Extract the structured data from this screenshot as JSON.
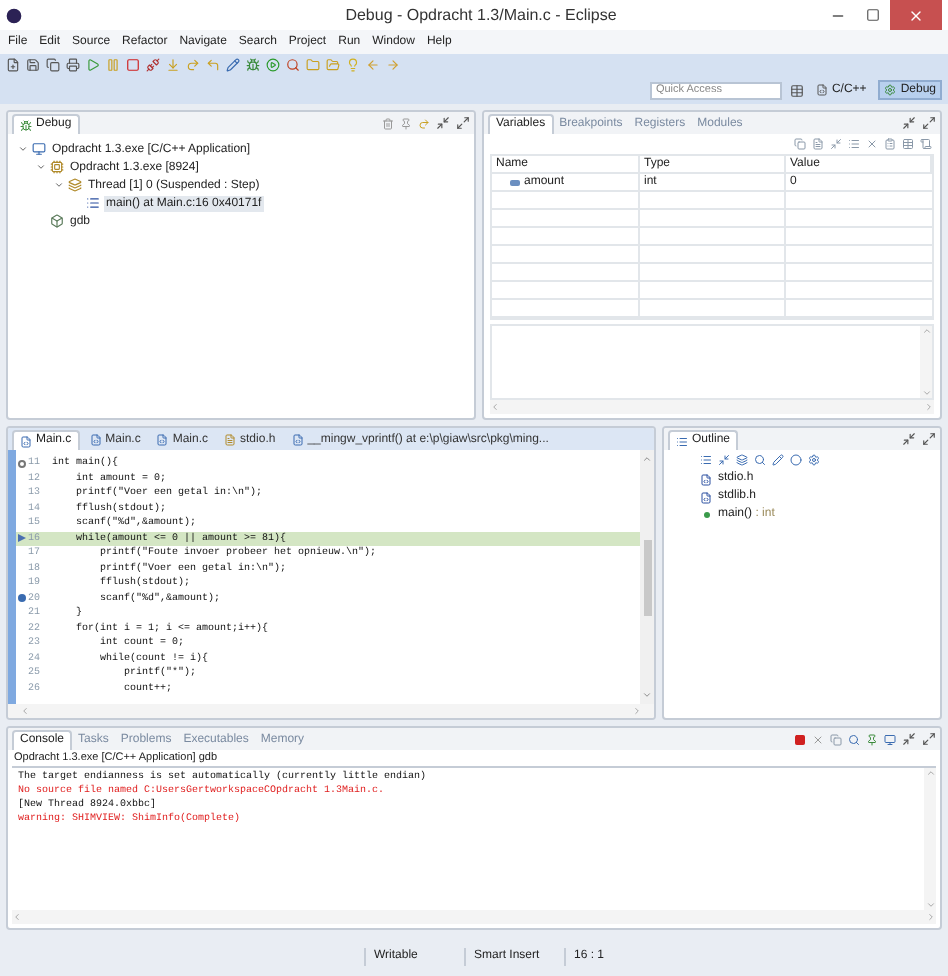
{
  "window": {
    "title": "Debug - Opdracht 1.3/Main.c - Eclipse"
  },
  "menu": [
    "File",
    "Edit",
    "Source",
    "Refactor",
    "Navigate",
    "Search",
    "Project",
    "Run",
    "Window",
    "Help"
  ],
  "quick_access": {
    "placeholder": "Quick Access"
  },
  "perspectives": [
    {
      "label": "C/C++",
      "selected": false
    },
    {
      "label": "Debug",
      "selected": true
    }
  ],
  "debug_view": {
    "tab": "Debug",
    "tree": [
      {
        "label": "Opdracht 1.3.exe [C/C++ Application]",
        "kind": "launch",
        "expanded": true,
        "selected": false,
        "children": [
          {
            "label": "Opdracht 1.3.exe [8924]",
            "kind": "process",
            "expanded": true,
            "selected": false,
            "children": [
              {
                "label": "Thread [1] 0 (Suspended : Step)",
                "kind": "thread",
                "expanded": true,
                "selected": false,
                "children": [
                  {
                    "label": "main() at Main.c:16 0x40171f",
                    "kind": "frame",
                    "selected": true
                  }
                ]
              }
            ]
          },
          {
            "label": "gdb",
            "kind": "debugger",
            "selected": false
          }
        ]
      }
    ]
  },
  "variables_view": {
    "tabs": [
      {
        "label": "Variables",
        "selected": true
      },
      {
        "label": "Breakpoints",
        "selected": false
      },
      {
        "label": "Registers",
        "selected": false
      },
      {
        "label": "Modules",
        "selected": false
      }
    ],
    "columns": [
      "Name",
      "Type",
      "Value"
    ],
    "rows": [
      {
        "name": "amount",
        "type": "int",
        "value": "0"
      }
    ]
  },
  "editor": {
    "tabs": [
      {
        "label": "Main.c",
        "kind": "source",
        "selected": true
      },
      {
        "label": "Main.c",
        "kind": "source",
        "selected": false
      },
      {
        "label": "Main.c",
        "kind": "source",
        "selected": false
      },
      {
        "label": "stdio.h",
        "kind": "header",
        "selected": false
      },
      {
        "label": "__mingw_vprintf() at e:\\p\\giaw\\src\\pkg\\ming...",
        "kind": "source",
        "selected": false
      }
    ],
    "lines": [
      {
        "number": "11",
        "text": "int main(){",
        "kind": "fold"
      },
      {
        "number": "12",
        "text": "    int amount = 0;",
        "kind": "plain"
      },
      {
        "number": "13",
        "text": "    printf(\"Voer een getal in:\\n\");",
        "kind": "plain"
      },
      {
        "number": "14",
        "text": "    fflush(stdout);",
        "kind": "plain"
      },
      {
        "number": "15",
        "text": "    scanf(\"%d\",&amount);",
        "kind": "plain"
      },
      {
        "number": "16",
        "text": "    while(amount <= 0 || amount >= 81){",
        "kind": "current"
      },
      {
        "number": "17",
        "text": "        printf(\"Foute invoer probeer het opnieuw.\\n\");",
        "kind": "plain"
      },
      {
        "number": "18",
        "text": "        printf(\"Voer een getal in:\\n\");",
        "kind": "plain"
      },
      {
        "number": "19",
        "text": "        fflush(stdout);",
        "kind": "plain"
      },
      {
        "number": "20",
        "text": "        scanf(\"%d\",&amount);",
        "kind": "breakpoint"
      },
      {
        "number": "21",
        "text": "    }",
        "kind": "plain"
      },
      {
        "number": "22",
        "text": "    for(int i = 1; i <= amount;i++){",
        "kind": "plain"
      },
      {
        "number": "23",
        "text": "        int count = 0;",
        "kind": "plain"
      },
      {
        "number": "24",
        "text": "        while(count != i){",
        "kind": "plain"
      },
      {
        "number": "25",
        "text": "            printf(\"*\");",
        "kind": "plain"
      },
      {
        "number": "26",
        "text": "            count++;",
        "kind": "plain"
      }
    ]
  },
  "outline": {
    "tab": "Outline",
    "items": [
      {
        "label": "stdio.h",
        "kind": "include"
      },
      {
        "label": "stdlib.h",
        "kind": "include"
      },
      {
        "label": "main()",
        "type": ": int",
        "kind": "function"
      }
    ]
  },
  "console": {
    "tabs": [
      {
        "label": "Console",
        "selected": true
      },
      {
        "label": "Tasks",
        "selected": false
      },
      {
        "label": "Problems",
        "selected": false
      },
      {
        "label": "Executables",
        "selected": false
      },
      {
        "label": "Memory",
        "selected": false
      }
    ],
    "process": "Opdracht 1.3.exe [C/C++ Application] gdb",
    "lines": [
      {
        "text": "The target endianness is set automatically (currently little endian)",
        "kind": "output"
      },
      {
        "text": "No source file named C:UsersGertworkspaceCOpdracht 1.3Main.c.",
        "kind": "error"
      },
      {
        "text": "[New Thread 8924.0xbbc]",
        "kind": "output"
      },
      {
        "text": "warning: SHIMVIEW: ShimInfo(Complete)",
        "kind": "error"
      }
    ]
  },
  "status_bar": [
    "Writable",
    "Smart Insert",
    "16 : 1"
  ]
}
